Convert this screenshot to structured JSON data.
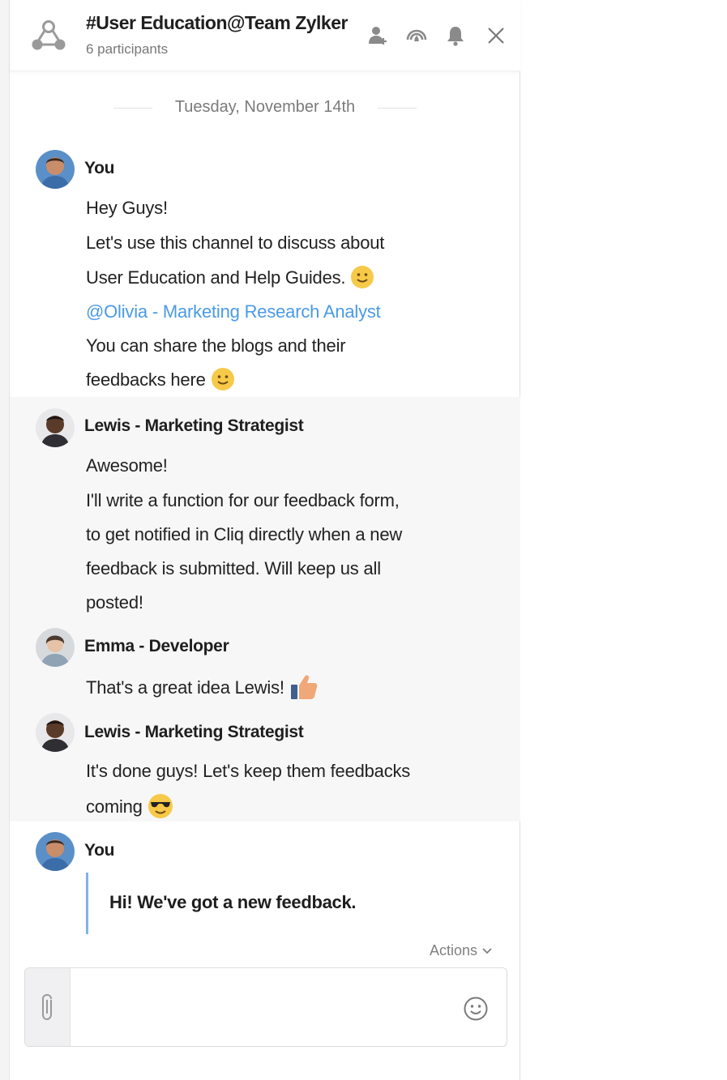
{
  "header": {
    "title": "#User Education@Team Zylker",
    "subtitle": "6 participants",
    "icons": [
      "add-participant-icon",
      "broadcast-icon",
      "bell-icon",
      "close-icon"
    ]
  },
  "date_divider": "Tuesday, November 14th",
  "messages": [
    {
      "sender": "You",
      "lines": [
        "Hey Guys!",
        "Let's use this channel to discuss about",
        "User Education and Help Guides.",
        "@Olivia - Marketing Research Analyst",
        "You can share the blogs and their",
        "feedbacks here"
      ]
    },
    {
      "sender": "Lewis - Marketing Strategist",
      "lines": [
        "Awesome!",
        "I'll write a function for our feedback form,",
        "to get notified in Cliq directly when a new",
        "feedback is submitted. Will keep us all",
        "posted!"
      ]
    },
    {
      "sender": "Emma - Developer",
      "lines": [
        "That's a great idea Lewis!"
      ]
    },
    {
      "sender": "Lewis - Marketing Strategist",
      "lines": [
        "It's done guys! Let's keep them feedbacks",
        "coming"
      ]
    },
    {
      "sender": "You",
      "quote": "Hi! We've got a new feedback."
    }
  ],
  "actions_label": "Actions",
  "composer": {
    "placeholder": ""
  },
  "colors": {
    "mention": "#4a9ae6",
    "quote_bar": "#7fb3e8",
    "shaded_bg": "#f7f7f8"
  }
}
